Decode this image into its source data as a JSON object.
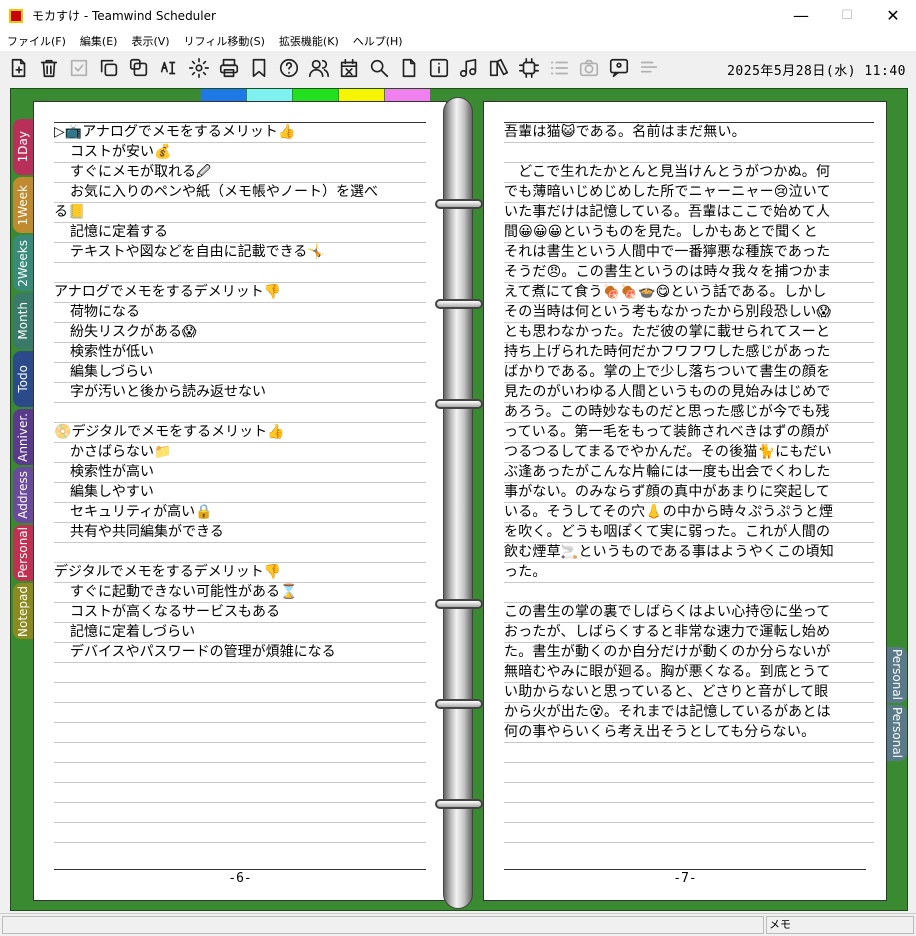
{
  "window": {
    "title": "モカすけ - Teamwind Scheduler",
    "minimize": "—",
    "maximize": "☐",
    "close": "✕"
  },
  "menu": [
    "ファイル(F)",
    "編集(E)",
    "表示(V)",
    "リフィル移動(S)",
    "拡張機能(K)",
    "ヘルプ(H)"
  ],
  "toolbar": [
    {
      "name": "new-document-icon",
      "enabled": true
    },
    {
      "name": "trash-icon",
      "enabled": true
    },
    {
      "name": "check-icon",
      "enabled": false
    },
    {
      "name": "copy-icon",
      "enabled": true
    },
    {
      "name": "duplicate-icon",
      "enabled": true
    },
    {
      "name": "spellcheck-icon",
      "enabled": true
    },
    {
      "name": "gear-icon",
      "enabled": true
    },
    {
      "name": "print-icon",
      "enabled": true
    },
    {
      "name": "bookmark-icon",
      "enabled": true
    },
    {
      "name": "help-icon",
      "enabled": true
    },
    {
      "name": "users-icon",
      "enabled": true
    },
    {
      "name": "calendar-delete-icon",
      "enabled": true
    },
    {
      "name": "search-icon",
      "enabled": true
    },
    {
      "name": "file-icon",
      "enabled": true
    },
    {
      "name": "info-icon",
      "enabled": true
    },
    {
      "name": "music-icon",
      "enabled": true
    },
    {
      "name": "book-icon",
      "enabled": true
    },
    {
      "name": "chip-icon",
      "enabled": true
    },
    {
      "name": "list-icon",
      "enabled": false
    },
    {
      "name": "camera-icon",
      "enabled": false
    },
    {
      "name": "speech-icon",
      "enabled": true
    },
    {
      "name": "align-icon",
      "enabled": false
    }
  ],
  "clock": "2025年5月28日(水) 11:40",
  "top_colors": [
    "#1e78e6",
    "#7ef0f0",
    "#22e01e",
    "#f5f500",
    "#f080f0"
  ],
  "left_tabs": [
    {
      "label": "1Day",
      "color": "#b8305a"
    },
    {
      "label": "1Week",
      "color": "#c08a30"
    },
    {
      "label": "2Weeks",
      "color": "#3a8a7a"
    },
    {
      "label": "Month",
      "color": "#3a7a6a"
    },
    {
      "label": "Todo",
      "color": "#2a4a8a"
    },
    {
      "label": "Anniver.",
      "color": "#5a3a8a"
    },
    {
      "label": "Address",
      "color": "#6a4a9a"
    },
    {
      "label": "Personal",
      "color": "#c03050"
    },
    {
      "label": "Notepad",
      "color": "#8a8a20"
    }
  ],
  "right_tabs": [
    {
      "label": "Personal"
    },
    {
      "label": "Personal"
    }
  ],
  "left_page": {
    "number": "-6-",
    "lines": [
      {
        "text": "アナログでメモをするメリット",
        "indent": false,
        "pre": "▷📺",
        "post": "👍"
      },
      {
        "text": "コストが安い",
        "indent": true,
        "post": "💰"
      },
      {
        "text": "すぐにメモが取れる",
        "indent": true,
        "post": "🖉"
      },
      {
        "text": "お気に入りのペンや紙（メモ帳やノート）を選べ",
        "indent": true,
        "post": ""
      },
      {
        "text": "る",
        "indent": false,
        "post": "📒"
      },
      {
        "text": "記憶に定着する",
        "indent": true,
        "post": ""
      },
      {
        "text": "テキストや図などを自由に記載できる",
        "indent": true,
        "post": "🤸"
      },
      {
        "text": "",
        "indent": false,
        "post": ""
      },
      {
        "text": "アナログでメモをするデメリット",
        "indent": false,
        "post": "👎"
      },
      {
        "text": "荷物になる",
        "indent": true,
        "post": ""
      },
      {
        "text": "紛失リスクがある",
        "indent": true,
        "post": "😱"
      },
      {
        "text": "検索性が低い",
        "indent": true,
        "post": ""
      },
      {
        "text": "編集しづらい",
        "indent": true,
        "post": ""
      },
      {
        "text": "字が汚いと後から読み返せない",
        "indent": true,
        "post": ""
      },
      {
        "text": "",
        "indent": false,
        "post": ""
      },
      {
        "text": "デジタルでメモをするメリット",
        "indent": false,
        "pre": "📀",
        "post": "👍"
      },
      {
        "text": "かさばらない",
        "indent": true,
        "post": "📁"
      },
      {
        "text": "検索性が高い",
        "indent": true,
        "post": ""
      },
      {
        "text": "編集しやすい",
        "indent": true,
        "post": ""
      },
      {
        "text": "セキュリティが高い",
        "indent": true,
        "post": "🔒"
      },
      {
        "text": "共有や共同編集ができる",
        "indent": true,
        "post": ""
      },
      {
        "text": "",
        "indent": false,
        "post": ""
      },
      {
        "text": "デジタルでメモをするデメリット",
        "indent": false,
        "post": "👎"
      },
      {
        "text": "すぐに起動できない可能性がある",
        "indent": true,
        "post": "⌛"
      },
      {
        "text": "コストが高くなるサービスもある",
        "indent": true,
        "post": ""
      },
      {
        "text": "記憶に定着しづらい",
        "indent": true,
        "post": ""
      },
      {
        "text": "デバイスやパスワードの管理が煩雑になる",
        "indent": true,
        "post": ""
      }
    ]
  },
  "right_page": {
    "number": "-7-",
    "lines": [
      "吾輩は猫😺である。名前はまだ無い。",
      "",
      "　どこで生れたかとんと見当けんとうがつかぬ。何",
      "でも薄暗いじめじめした所でニャーニャー😢泣いて",
      "いた事だけは記憶している。吾輩はここで始めて人",
      "間😀😀😀というものを見た。しかもあとで聞くと",
      "それは書生という人間中で一番獰悪な種族であった",
      "そうだ😠。この書生というのは時々我々を捕つかま",
      "えて煮にて食う🍖🍖🍲😋という話である。しかし",
      "その当時は何という考もなかったから別段恐しい😱",
      "とも思わなかった。ただ彼の掌に載せられてスーと",
      "持ち上げられた時何だかフワフワした感じがあった",
      "ばかりである。掌の上で少し落ちついて書生の顔を",
      "見たのがいわゆる人間というものの見始みはじめで",
      "あろう。この時妙なものだと思った感じが今でも残",
      "っている。第一毛をもって装飾されべきはずの顔が",
      "つるつるしてまるでやかんだ。その後猫🐈にもだい",
      "ぶ逢あったがこんな片輪には一度も出会でくわした",
      "事がない。のみならず顔の真中があまりに突起して",
      "いる。そうしてその穴👃の中から時々ぷうぷうと煙",
      "を吹く。どうも咽ぽくて実に弱った。これが人間の",
      "飲む煙草🚬というものである事はようやくこの頃知",
      "った。",
      "",
      "この書生の掌の裏でしばらくはよい心持😚に坐って",
      "おったが、しばらくすると非常な速力で運転し始め",
      "た。書生が動くのか自分だけが動くのか分らないが",
      "無暗むやみに眼が廻る。胸が悪くなる。到底とうて",
      "い助からないと思っていると、どさりと音がして眼",
      "から火が出た😵。それまでは記憶しているがあとは",
      "何の事やらいくら考え出そうとしても分らない。"
    ]
  },
  "status": {
    "right": "メモ"
  }
}
